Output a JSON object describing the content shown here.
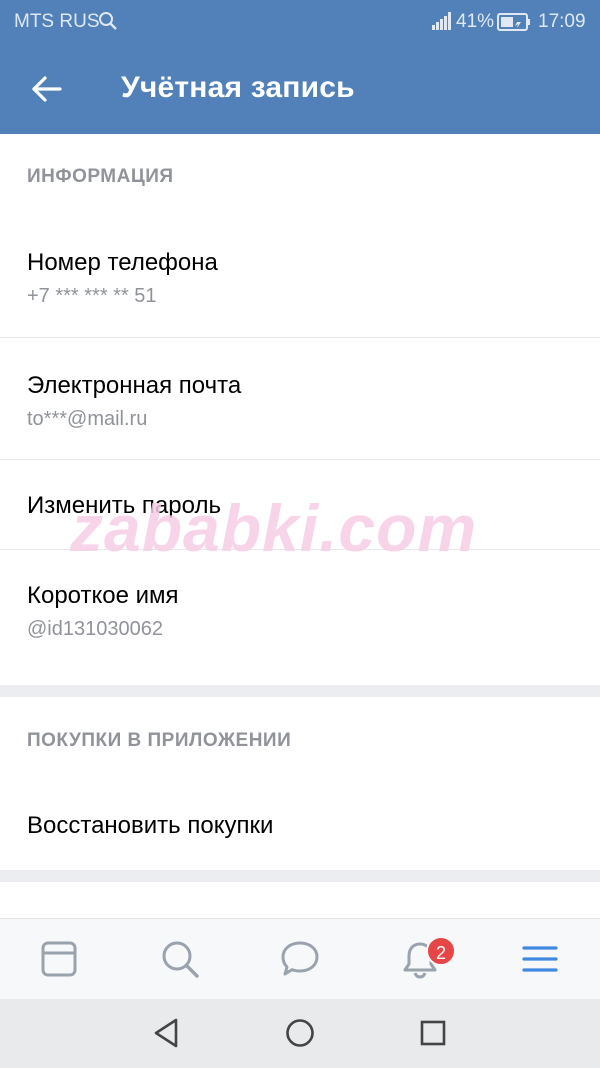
{
  "status_bar": {
    "carrier": "MTS RUS",
    "battery": "41%",
    "time": "17:09"
  },
  "app_bar": {
    "title": "Учётная запись"
  },
  "sections": {
    "info": {
      "header": "ИНФОРМАЦИЯ",
      "phone": {
        "title": "Номер телефона",
        "value": "+7 *** *** ** 51"
      },
      "email": {
        "title": "Электронная почта",
        "value": "to***@mail.ru"
      },
      "password": {
        "title": "Изменить пароль"
      },
      "short_name": {
        "title": "Короткое имя",
        "value": "@id131030062"
      }
    },
    "purchases": {
      "header": "ПОКУПКИ В ПРИЛОЖЕНИИ",
      "restore": {
        "title": "Восстановить покупки"
      }
    }
  },
  "watermark": "zababki.com",
  "tab_bar": {
    "notifications_badge": "2"
  },
  "colors": {
    "accent": "#5181b8",
    "icon_blue": "#3f8ae0",
    "icon_gray": "#99a2ad",
    "badge": "#e64646"
  }
}
